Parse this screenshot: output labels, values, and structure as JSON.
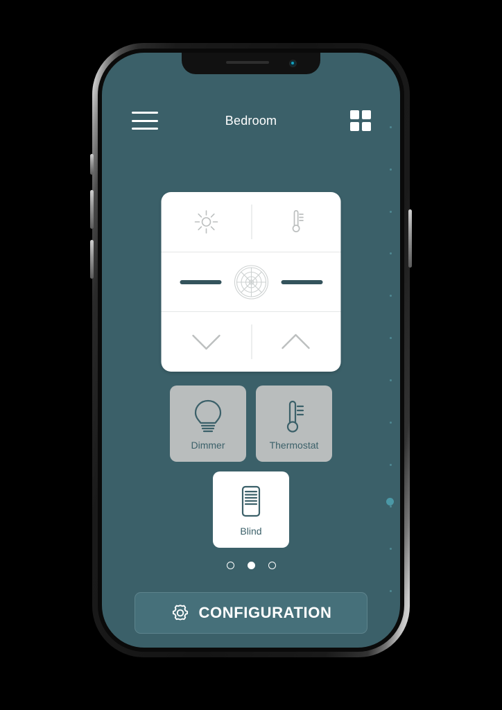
{
  "app": {
    "header": {
      "title": "Bedroom",
      "menu_icon": "hamburger-menu-icon",
      "grid_icon": "grid-view-icon"
    },
    "control_panel": {
      "rows": [
        {
          "left": {
            "icon": "brightness-sun-icon",
            "name": "brightness-control"
          },
          "right": {
            "icon": "thermometer-icon",
            "name": "temperature-control"
          }
        },
        {
          "center": {
            "icon": "motion-sensor-icon",
            "name": "motion-sensor-control"
          },
          "left_bar": "slider-bar-left",
          "right_bar": "slider-bar-right"
        },
        {
          "left": {
            "icon": "chevron-down-icon",
            "name": "blind-down-control"
          },
          "right": {
            "icon": "chevron-up-icon",
            "name": "blind-up-control"
          }
        }
      ]
    },
    "devices": [
      {
        "label": "Dimmer",
        "icon": "light-bulb-icon",
        "active": false
      },
      {
        "label": "Thermostat",
        "icon": "thermometer-icon",
        "active": false
      },
      {
        "label": "Blind",
        "icon": "window-blind-icon",
        "active": true
      }
    ],
    "pagination": {
      "total": 3,
      "active_index": 1
    },
    "config_button": {
      "label": "CONFIGURATION",
      "icon": "gear-icon"
    },
    "colors": {
      "background": "#3b6069",
      "panel": "#ffffff",
      "tile": "#b9bdbd",
      "tile_active": "#ffffff",
      "accent": "#46707a",
      "text_dark": "#3b6069",
      "text_light": "#ffffff",
      "bar": "#34535c",
      "scroll_thumb": "#4b98a6"
    }
  }
}
